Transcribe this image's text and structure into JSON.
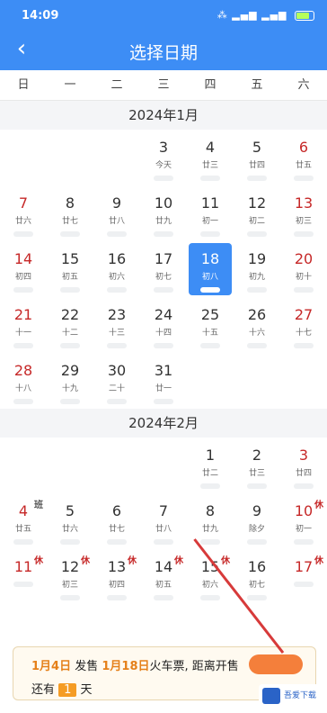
{
  "status": {
    "time": "14:09",
    "icons_text": "⁂ ▂▄▆ ▂▄▆"
  },
  "nav": {
    "title": "选择日期",
    "back_icon": "chevron-left-icon"
  },
  "weekdays": [
    "日",
    "一",
    "二",
    "三",
    "四",
    "五",
    "六"
  ],
  "months": [
    {
      "title": "2024年1月",
      "days": [
        {
          "num": "",
          "sub": ""
        },
        {
          "num": "",
          "sub": ""
        },
        {
          "num": "",
          "sub": ""
        },
        {
          "num": "3",
          "sub": "今天"
        },
        {
          "num": "4",
          "sub": "廿三"
        },
        {
          "num": "5",
          "sub": "廿四"
        },
        {
          "num": "6",
          "sub": "廿五"
        },
        {
          "num": "7",
          "sub": "廿六"
        },
        {
          "num": "8",
          "sub": "廿七"
        },
        {
          "num": "9",
          "sub": "廿八"
        },
        {
          "num": "10",
          "sub": "廿九"
        },
        {
          "num": "11",
          "sub": "初一"
        },
        {
          "num": "12",
          "sub": "初二"
        },
        {
          "num": "13",
          "sub": "初三"
        },
        {
          "num": "14",
          "sub": "初四"
        },
        {
          "num": "15",
          "sub": "初五"
        },
        {
          "num": "16",
          "sub": "初六"
        },
        {
          "num": "17",
          "sub": "初七"
        },
        {
          "num": "18",
          "sub": "初八"
        },
        {
          "num": "19",
          "sub": "初九"
        },
        {
          "num": "20",
          "sub": "初十"
        },
        {
          "num": "21",
          "sub": "十一"
        },
        {
          "num": "22",
          "sub": "十二"
        },
        {
          "num": "23",
          "sub": "十三"
        },
        {
          "num": "24",
          "sub": "十四"
        },
        {
          "num": "25",
          "sub": "十五"
        },
        {
          "num": "26",
          "sub": "十六"
        },
        {
          "num": "27",
          "sub": "十七"
        },
        {
          "num": "28",
          "sub": "十八"
        },
        {
          "num": "29",
          "sub": "十九"
        },
        {
          "num": "30",
          "sub": "二十"
        },
        {
          "num": "31",
          "sub": "廿一"
        }
      ]
    },
    {
      "title": "2024年2月",
      "days": [
        {
          "num": "",
          "sub": ""
        },
        {
          "num": "",
          "sub": ""
        },
        {
          "num": "",
          "sub": ""
        },
        {
          "num": "",
          "sub": ""
        },
        {
          "num": "1",
          "sub": "廿二"
        },
        {
          "num": "2",
          "sub": "廿三"
        },
        {
          "num": "3",
          "sub": "廿四"
        },
        {
          "num": "4",
          "sub": "廿五",
          "flag": "班"
        },
        {
          "num": "5",
          "sub": "廿六"
        },
        {
          "num": "6",
          "sub": "廿七"
        },
        {
          "num": "7",
          "sub": "廿八"
        },
        {
          "num": "8",
          "sub": "廿九"
        },
        {
          "num": "9",
          "sub": "除夕"
        },
        {
          "num": "10",
          "sub": "初一",
          "flag": "休"
        },
        {
          "num": "11",
          "sub": "",
          "flag": "休"
        },
        {
          "num": "12",
          "sub": "初三",
          "flag": "休"
        },
        {
          "num": "13",
          "sub": "初四",
          "flag": "休"
        },
        {
          "num": "14",
          "sub": "初五",
          "flag": "休"
        },
        {
          "num": "15",
          "sub": "初六",
          "flag": "休"
        },
        {
          "num": "16",
          "sub": "初七"
        },
        {
          "num": "17",
          "sub": "",
          "flag": "休"
        }
      ]
    }
  ],
  "banner": {
    "date1": "1月4日",
    "text1": " 发售 ",
    "date2": "1月18日",
    "text2": "火车票, 距离开售",
    "prefix": "还有 ",
    "count": "1",
    "suffix": " 天"
  },
  "selected_day": "18",
  "logo": "吾爱下载网",
  "colors": {
    "accent": "#3d8df5",
    "holiday": "#c62828",
    "banner_highlight": "#e5801a"
  }
}
